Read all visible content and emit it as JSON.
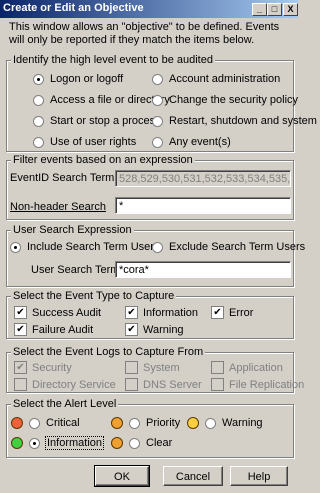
{
  "window": {
    "title": "Create or Edit an Objective",
    "minimize": "_",
    "maximize": "□",
    "close": "X",
    "intro": "This window allows an \"objective\" to be defined. Events will only be reported if they match the items below."
  },
  "event_group": {
    "title": "Identify the high level event to be audited",
    "options": [
      "Logon or logoff",
      "Account administration",
      "Access a file or directory",
      "Change the security policy",
      "Start or stop a process",
      "Restart, shutdown and system",
      "Use of user rights",
      "Any event(s)"
    ],
    "selected": "Logon or logoff"
  },
  "filter_group": {
    "title": "Filter events based on an expression",
    "eventid_label": "EventID Search Term",
    "eventid_value": "528,529,530,531,532,533,534,535,536,537",
    "nonheader_label": "Non-header Search",
    "nonheader_value": "*"
  },
  "user_group": {
    "title": "User Search Expression",
    "include_label": "Include Search Term Users",
    "exclude_label": "Exclude Search Term Users",
    "selected": "Include Search Term Users",
    "term_label": "User Search Term",
    "term_value": "*cora*"
  },
  "type_group": {
    "title": "Select the Event Type to Capture",
    "items": [
      {
        "label": "Success Audit",
        "checked": true
      },
      {
        "label": "Information",
        "checked": true
      },
      {
        "label": "Error",
        "checked": true
      },
      {
        "label": "Failure Audit",
        "checked": true
      },
      {
        "label": "Warning",
        "checked": true
      }
    ]
  },
  "logs_group": {
    "title": "Select the Event Logs to Capture From",
    "items": [
      {
        "label": "Security",
        "checked": true
      },
      {
        "label": "System",
        "checked": false
      },
      {
        "label": "Application",
        "checked": false
      },
      {
        "label": "Directory Service",
        "checked": false
      },
      {
        "label": "DNS Server",
        "checked": false
      },
      {
        "label": "File Replication",
        "checked": false
      }
    ]
  },
  "alert_group": {
    "title": "Select the Alert Level",
    "items": [
      {
        "label": "Critical",
        "color": "#f0603a"
      },
      {
        "label": "Priority",
        "color": "#f0a030"
      },
      {
        "label": "Warning",
        "color": "#f8d040"
      },
      {
        "label": "Information",
        "color": "#40d040"
      },
      {
        "label": "Clear",
        "color": "#f0a030"
      }
    ],
    "selected": "Information"
  },
  "buttons": {
    "ok": "OK",
    "cancel": "Cancel",
    "help": "Help"
  }
}
